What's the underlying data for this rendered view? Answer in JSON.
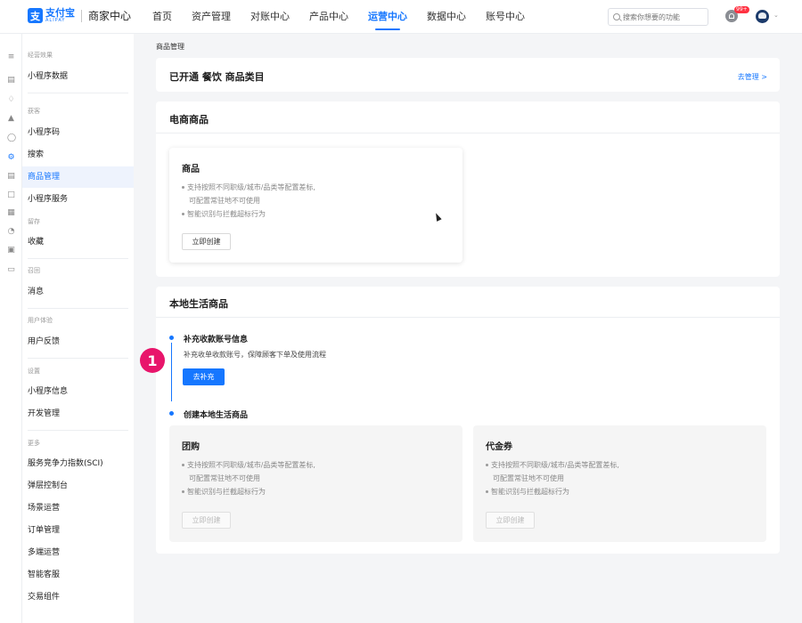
{
  "header": {
    "logo_mark": "支",
    "logo_cn": "支付宝",
    "logo_en": "ALIPAY",
    "app_name": "商家中心",
    "nav": [
      "首页",
      "资产管理",
      "对账中心",
      "产品中心",
      "运营中心",
      "数据中心",
      "账号中心"
    ],
    "active_nav": "运营中心",
    "search_placeholder": "搜索你想要的功能",
    "notification_badge": "99+"
  },
  "sidebar": {
    "groups": [
      {
        "label": "经营效果",
        "items": [
          "小程序数据"
        ]
      },
      {
        "label": "获客",
        "items": [
          "小程序码",
          "搜索",
          "商品管理",
          "小程序服务"
        ]
      },
      {
        "label": "留存",
        "items": [
          "收藏"
        ]
      },
      {
        "label": "召回",
        "items": [
          "消息"
        ]
      },
      {
        "label": "用户体验",
        "items": [
          "用户反馈"
        ]
      },
      {
        "label": "设置",
        "items": [
          "小程序信息",
          "开发管理"
        ]
      },
      {
        "label": "更多",
        "items": [
          "服务竞争力指数(SCI)",
          "弹层控制台",
          "场景运营",
          "订单管理",
          "多端运营",
          "智能客服",
          "交易组件"
        ]
      }
    ],
    "active_item": "商品管理"
  },
  "breadcrumb": "商品管理",
  "category_card": {
    "title": "已开通 餐饮 商品类目",
    "link": "去管理 >"
  },
  "ecommerce_card": {
    "title": "电商商品",
    "product": {
      "title": "商品",
      "lines": [
        "支持按照不同职级/城市/品类等配置差标,",
        "可配置常驻地不可使用",
        "智能识别与拦截超标行为"
      ],
      "button": "立即创建"
    }
  },
  "local_card": {
    "title": "本地生活商品",
    "step1": {
      "title": "补充收款账号信息",
      "desc": "补充收单收款账号，保障顾客下单及使用流程",
      "button": "去补充"
    },
    "step2": {
      "title": "创建本地生活商品"
    },
    "group_buy": {
      "title": "团购",
      "lines": [
        "支持按照不同职级/城市/品类等配置差标,",
        "可配置常驻地不可使用",
        "智能识别与拦截超标行为"
      ],
      "button": "立即创建"
    },
    "voucher": {
      "title": "代金券",
      "lines": [
        "支持按照不同职级/城市/品类等配置差标,",
        "可配置常驻地不可使用",
        "智能识别与拦截超标行为"
      ],
      "button": "立即创建"
    }
  },
  "annotation_marker": "1",
  "colors": {
    "accent": "#1677ff",
    "marker": "#e8156b"
  }
}
